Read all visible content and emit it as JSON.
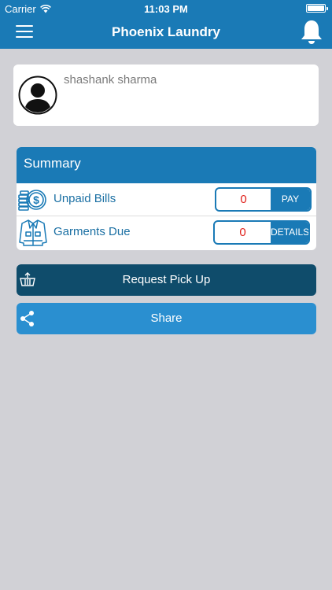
{
  "status_bar": {
    "carrier": "Carrier",
    "time": "11:03 PM"
  },
  "navbar": {
    "title": "Phoenix Laundry",
    "left_icon": "hamburger-menu-icon",
    "right_icon": "bell-icon"
  },
  "profile": {
    "name": "shashank sharma",
    "avatar_icon": "user-avatar-icon"
  },
  "summary": {
    "title": "Summary",
    "rows": [
      {
        "label": "Unpaid Bills",
        "value": "0",
        "action": "PAY",
        "icon": "coins-dollar-icon"
      },
      {
        "label": "Garments Due",
        "value": "0",
        "action": "DETAILS",
        "icon": "jacket-icon"
      }
    ]
  },
  "actions": {
    "pickup_label": "Request Pick Up",
    "pickup_icon": "pickup-basket-icon",
    "share_label": "Share",
    "share_icon": "share-icon"
  },
  "colors": {
    "primary": "#1a7ab6",
    "dark_primary": "#0f4c6b",
    "share_blue": "#2a8fd0",
    "background": "#d1d1d6",
    "value_red": "#e0201a",
    "label_blue": "#1a6fa3"
  }
}
